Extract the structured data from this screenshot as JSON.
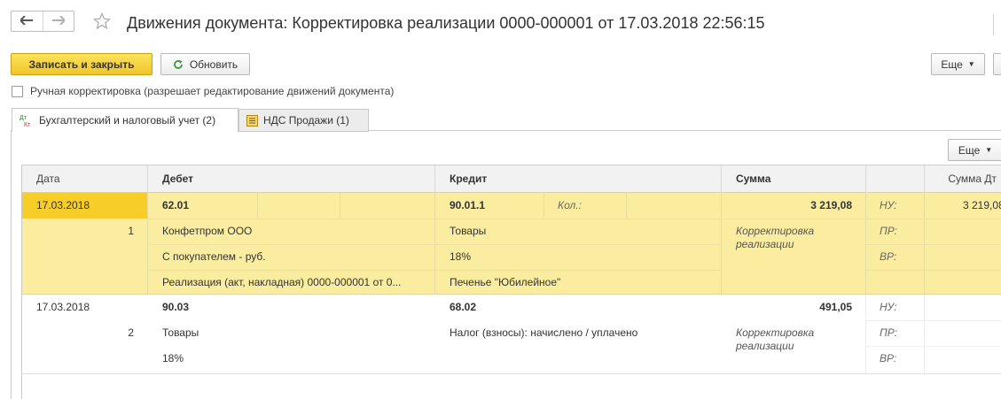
{
  "window": {
    "title": "Движения документа: Корректировка реализации 0000-000001 от 17.03.2018 22:56:15"
  },
  "toolbar": {
    "save_close_label": "Записать и закрыть",
    "refresh_label": "Обновить",
    "more_label": "Еще"
  },
  "manual_correction": {
    "label": "Ручная корректировка (разрешает редактирование движений документа)",
    "checked": false
  },
  "tabs": [
    {
      "label": "Бухгалтерский и налоговый учет (2)",
      "icon": "dt-kt-icon",
      "active": true
    },
    {
      "label": "НДС Продажи (1)",
      "icon": "register-icon",
      "active": false
    }
  ],
  "grid": {
    "more_label": "Еще",
    "columns": {
      "date": "Дата",
      "debit": "Дебет",
      "credit": "Кредит",
      "sum": "Сумма",
      "sum_dt": "Сумма Дт"
    },
    "rows": [
      {
        "date": "17.03.2018",
        "number": "1",
        "debit_account": "62.01",
        "debit_sub1": "Конфетпром ООО",
        "debit_sub2": "С покупателем - руб.",
        "debit_sub3": "Реализация (акт, накладная) 0000-000001 от 0...",
        "credit_account": "90.01.1",
        "credit_qty_label": "Кол.:",
        "credit_sub1": "Товары",
        "credit_sub2": "18%",
        "credit_sub3": "Печенье \"Юбилейное\"",
        "sum": "3 219,08",
        "content": "Корректировка реализации",
        "nu_label": "НУ:",
        "pr_label": "ПР:",
        "vr_label": "ВР:",
        "sum_dt": "3 219,08"
      },
      {
        "date": "17.03.2018",
        "number": "2",
        "debit_account": "90.03",
        "debit_sub1": "Товары",
        "debit_sub2": "18%",
        "credit_account": "68.02",
        "credit_sub1": "Налог (взносы): начислено / уплачено",
        "sum": "491,05",
        "content": "Корректировка реализации",
        "nu_label": "НУ:",
        "pr_label": "ПР:",
        "vr_label": "ВР:"
      }
    ]
  },
  "colors": {
    "primary_button": "#f6d03d",
    "selected_row": "#fbeda0",
    "selected_date_cell": "#f7cd2a",
    "refresh_icon": "#3a9a3a"
  }
}
